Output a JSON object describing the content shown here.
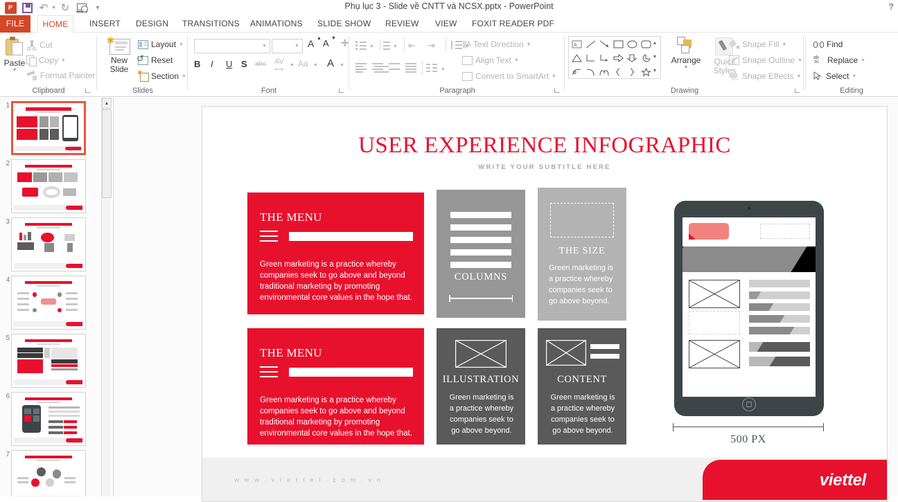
{
  "window": {
    "title": "Phụ lục 3 - Slide về CNTT và NCSX.pptx - PowerPoint",
    "help_label": "?",
    "quick_access": [
      {
        "name": "powerpoint-logo",
        "label": "P"
      },
      {
        "name": "save-icon",
        "label": ""
      },
      {
        "name": "undo-icon",
        "label": "↶"
      },
      {
        "name": "redo-icon",
        "label": "↻"
      },
      {
        "name": "start-presentation-icon",
        "label": ""
      },
      {
        "name": "customize-qat-icon",
        "label": "≡"
      }
    ]
  },
  "tabs": [
    {
      "label": "FILE",
      "active": false,
      "file": true
    },
    {
      "label": "HOME",
      "active": true
    },
    {
      "label": "INSERT",
      "active": false
    },
    {
      "label": "DESIGN",
      "active": false
    },
    {
      "label": "TRANSITIONS",
      "active": false
    },
    {
      "label": "ANIMATIONS",
      "active": false
    },
    {
      "label": "SLIDE SHOW",
      "active": false
    },
    {
      "label": "REVIEW",
      "active": false
    },
    {
      "label": "VIEW",
      "active": false
    },
    {
      "label": "FOXIT READER PDF",
      "active": false
    }
  ],
  "ribbon": {
    "clipboard": {
      "label": "Clipboard",
      "paste": "Paste",
      "cut": "Cut",
      "copy": "Copy",
      "format_painter": "Format Painter"
    },
    "slides": {
      "label": "Slides",
      "new_slide_line1": "New",
      "new_slide_line2": "Slide",
      "layout": "Layout",
      "reset": "Reset",
      "section": "Section"
    },
    "font": {
      "label": "Font",
      "font_name_value": "",
      "font_size_value": "",
      "bold": "B",
      "italic": "I",
      "underline": "U",
      "shadow": "S",
      "strikethrough": "abc",
      "char_spacing": "AV",
      "change_case": "Aa",
      "font_color": "A",
      "grow_font": "A",
      "shrink_font": "A"
    },
    "paragraph": {
      "label": "Paragraph",
      "text_direction": "Text Direction",
      "align_text": "Align Text",
      "convert_smartart": "Convert to SmartArt"
    },
    "drawing": {
      "label": "Drawing",
      "arrange": "Arrange",
      "quick_styles_line1": "Quick",
      "quick_styles_line2": "Styles",
      "shape_fill": "Shape Fill",
      "shape_outline": "Shape Outline",
      "shape_effects": "Shape Effects"
    },
    "editing": {
      "label": "Editing",
      "find": "Find",
      "replace": "Replace",
      "select": "Select"
    }
  },
  "thumbnails": [
    {
      "number": "1",
      "selected": true
    },
    {
      "number": "2",
      "selected": false
    },
    {
      "number": "3",
      "selected": false
    },
    {
      "number": "4",
      "selected": false
    },
    {
      "number": "5",
      "selected": false
    },
    {
      "number": "6",
      "selected": false
    },
    {
      "number": "7",
      "selected": false
    }
  ],
  "slide": {
    "title": "USER EXPERIENCE INFOGRAPHIC",
    "subtitle": "WRITE YOUR SUBTITLE HERE",
    "menu_panel_1": {
      "heading": "THE MENU",
      "body": "Green marketing is a practice whereby companies seek to go above and beyond traditional marketing by promoting environmental core values in the hope that."
    },
    "menu_panel_2": {
      "heading": "THE MENU",
      "body": "Green marketing is a practice whereby companies seek to go above and beyond traditional marketing by promoting environmental core values in the hope that."
    },
    "columns_panel": {
      "caption": "COLUMNS"
    },
    "size_panel": {
      "caption": "THE SIZE",
      "body": "Green marketing is a practice whereby companies seek to go above beyond."
    },
    "illustration_panel": {
      "caption": "ILLUSTRATION",
      "body": "Green marketing is a practice whereby companies seek to go above beyond."
    },
    "content_panel": {
      "caption": "CONTENT",
      "body": "Green marketing is a practice whereby companies seek to go above beyond."
    },
    "tablet_measure_label": "500 PX",
    "footer_url": "w w w . v i e t t e l . c o m . v n",
    "brand": "viettel"
  },
  "colors": {
    "brand_red": "#e8112d",
    "file_tab": "#d24726",
    "gray_panel": "#969696",
    "light_gray_panel": "#b3b3b3",
    "dark_gray_panel": "#5a5a5a",
    "tablet_body": "#3d4548"
  }
}
